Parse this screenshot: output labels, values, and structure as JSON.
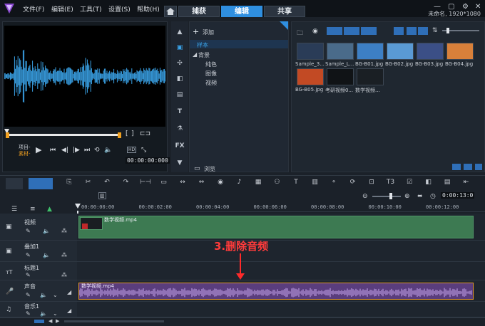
{
  "menu": [
    "文件(F)",
    "编辑(E)",
    "工具(T)",
    "设置(S)",
    "帮助(H)"
  ],
  "tabs": [
    "捕获",
    "编辑",
    "共享"
  ],
  "project_info": "未命名, 1920*1080",
  "preview": {
    "project_label": "项目-",
    "clip_label": "素材-",
    "quality": "HD",
    "timecode": "00:00:00:000"
  },
  "library": {
    "add_label": "添加",
    "tree": [
      "样本",
      "背景",
      "纯色",
      "图像",
      "视频"
    ],
    "browse_label": "浏览"
  },
  "media": [
    {
      "name": "Sample_3...",
      "color": "#2a3c57"
    },
    {
      "name": "Sample_L...",
      "color": "#4a6b8a"
    },
    {
      "name": "BG-B01.jpg",
      "color": "#3d7fc4"
    },
    {
      "name": "BG-B02.jpg",
      "color": "#5a9ad4"
    },
    {
      "name": "BG-B03.jpg",
      "color": "#3b4f86"
    },
    {
      "name": "BG-B04.jpg",
      "color": "#d8803a"
    },
    {
      "name": "BG-B05.jpg",
      "color": "#c24a24"
    },
    {
      "name": "考研视频0...",
      "color": "#101316"
    },
    {
      "name": "数学视频...",
      "color": "#1a1f24"
    }
  ],
  "timeline": {
    "zoom_timecode": "0:00:13:0",
    "ruler_ticks": [
      "00:00:00:00",
      "00:00:02:00",
      "00:00:04:00",
      "00:00:06:00",
      "00:00:08:00",
      "00:00:10:00",
      "00:00:12:00"
    ],
    "tracks": [
      {
        "name": "视频",
        "clip": "数学视频.mp4"
      },
      {
        "name": "叠加1",
        "clip": ""
      },
      {
        "name": "标题1",
        "clip": ""
      },
      {
        "name": "声音",
        "clip": "数学视频.mp4"
      },
      {
        "name": "音乐1",
        "clip": ""
      }
    ]
  },
  "annotation": "3.删除音频",
  "colors": {
    "accent": "#2f8fe0",
    "video_clip": "#3d7a52",
    "audio_clip": "#5a3d7d",
    "annotation": "#ff3b3b"
  }
}
